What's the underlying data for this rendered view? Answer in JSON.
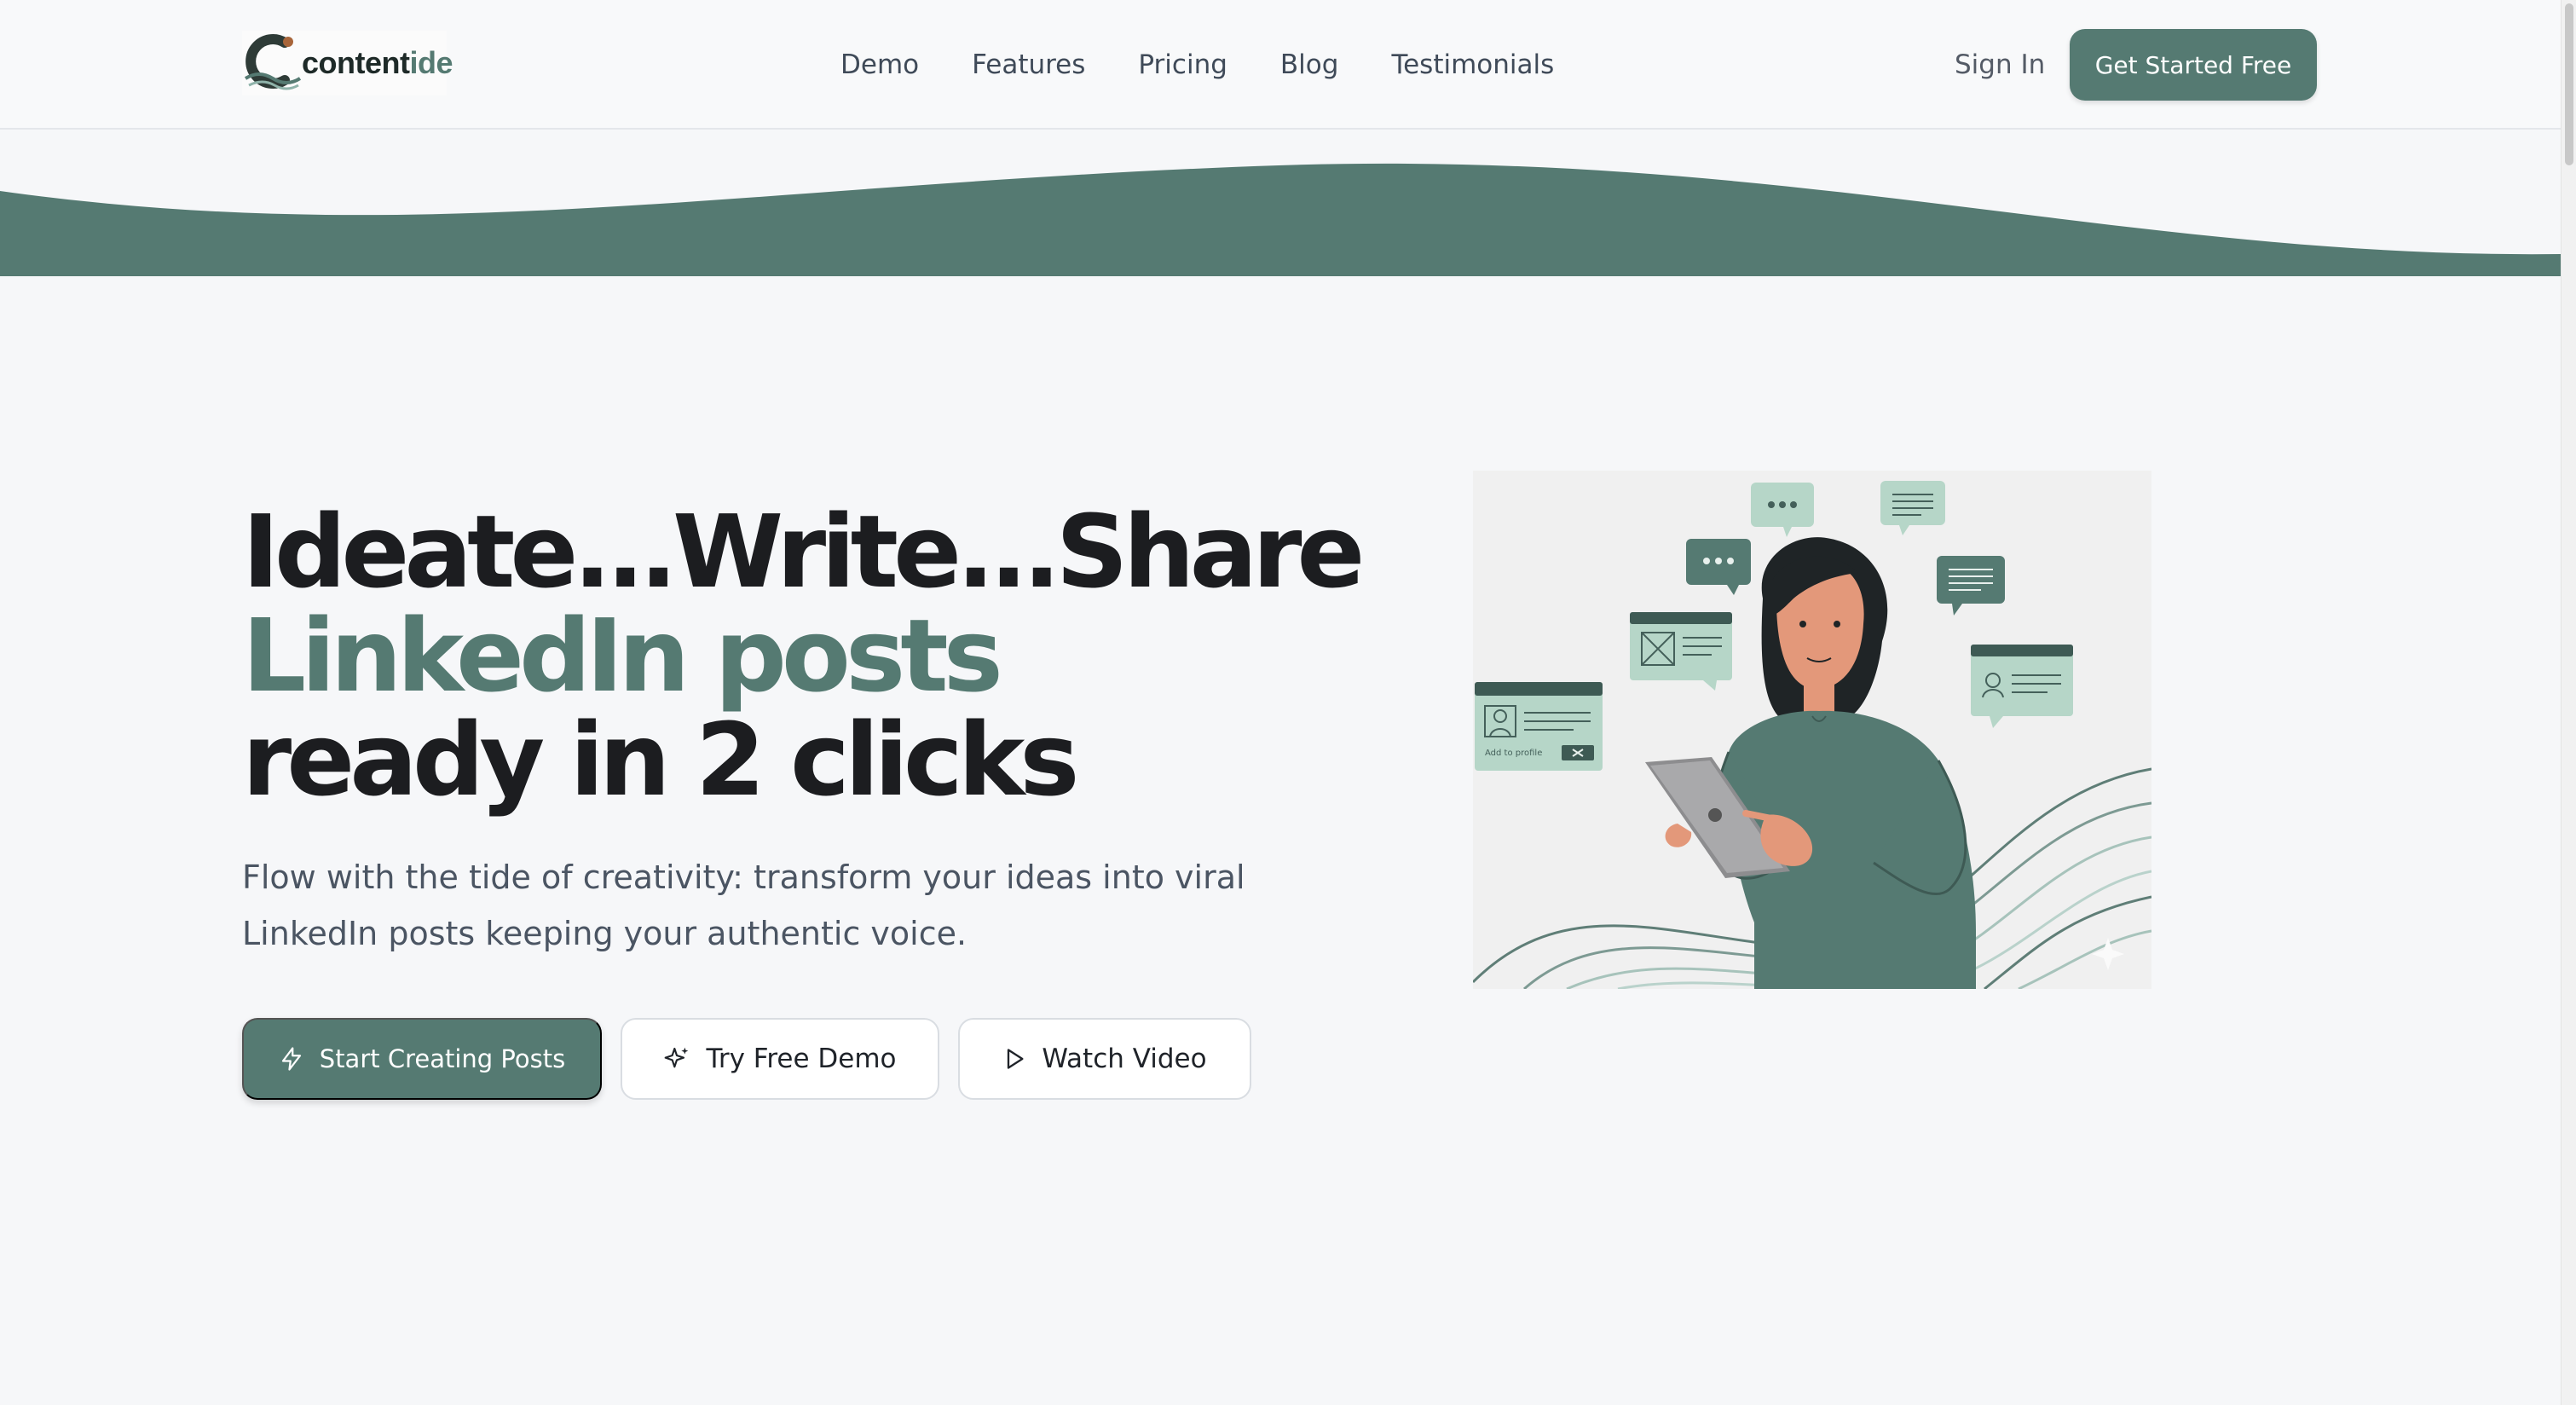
{
  "brand": {
    "name_prefix": "content",
    "name_suffix": "ide",
    "primary_color": "#557a72",
    "dark_color": "#1c1d20"
  },
  "nav": {
    "items": [
      {
        "label": "Demo"
      },
      {
        "label": "Features"
      },
      {
        "label": "Pricing"
      },
      {
        "label": "Blog"
      },
      {
        "label": "Testimonials"
      }
    ],
    "sign_in": "Sign In",
    "cta": "Get Started Free"
  },
  "hero": {
    "line1": "Ideate...Write...Share",
    "line2": "LinkedIn posts",
    "line3": "ready in 2 clicks",
    "subtitle": "Flow with the tide of creativity: transform your ideas into viral LinkedIn posts keeping your authentic voice.",
    "buttons": {
      "primary": "Start Creating Posts",
      "demo": "Try Free Demo",
      "video": "Watch Video"
    }
  },
  "illustration": {
    "card_caption": "Add to profile"
  }
}
